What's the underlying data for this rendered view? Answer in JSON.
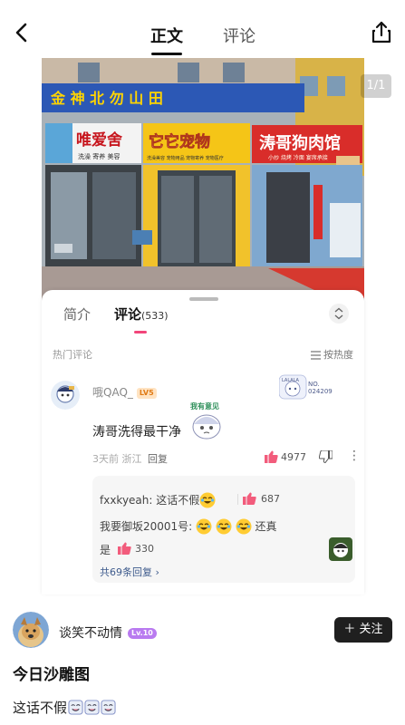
{
  "header": {
    "back_icon": "chevron-left-icon",
    "tabs": [
      {
        "label": "正文",
        "active": true
      },
      {
        "label": "评论",
        "active": false
      }
    ],
    "share_icon": "share-icon"
  },
  "photo": {
    "page_indicator": "1/1",
    "signs": {
      "top_banner": "金 神 北 勿 山 田",
      "left_shop": "唯爱舍",
      "left_shop_sub": "洗澡 寄养 美容",
      "center_shop": "它它宠物",
      "center_shop_sub": "洗澡美容 宠物用品 宠物寄养 宠物医疗",
      "right_shop": "涛哥狗肉馆",
      "right_shop_sub": "小炒 烧烤 冷面 宴席承接"
    }
  },
  "comment_card": {
    "tabs": {
      "intro": "简介",
      "comments": "评论",
      "comments_count": "(533)"
    },
    "hot_label": "热门评论",
    "sort_label": "按热度",
    "top_comment": {
      "username": "哦QAQ_",
      "level": "LV5",
      "sticker_no_label": "NO.",
      "sticker_no_value": "024209",
      "sticker_top_text": "LALALA",
      "text": "涛哥洗得最干净",
      "emoji_caption": "我有意见",
      "time": "3天前",
      "location": "浙江",
      "reply_label": "回复",
      "likes": "4977"
    },
    "replies": [
      {
        "user": "fxxkyeah:",
        "text": "这话不假",
        "likes": "687"
      },
      {
        "user": "我要御坂20001号:",
        "text": "还真",
        "text_cont": "是",
        "likes": "330"
      }
    ],
    "more_replies": "共69条回复 ›"
  },
  "author": {
    "name": "谈笑不动情",
    "level": "Lv.10",
    "follow_label": "＋ 关注"
  },
  "post": {
    "title": "今日沙雕图",
    "body": "这话不假"
  },
  "colors": {
    "accent_pink": "#f2457a",
    "like_pink": "#f25c7c",
    "follow_button_bg": "#1f1f1f",
    "level_purple": "#b97af0"
  }
}
